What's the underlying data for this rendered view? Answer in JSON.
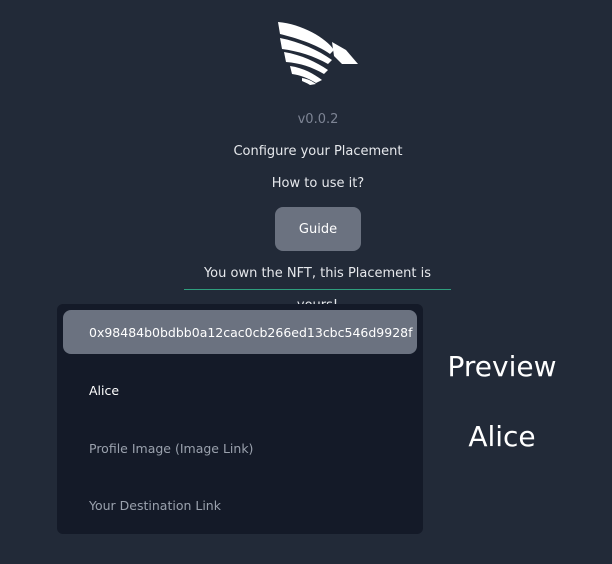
{
  "header": {
    "logo_icon": "wing-logo-icon",
    "version": "v0.0.2",
    "subtitle": "Configure your Placement",
    "howto": "How to use it?",
    "guide_label": "Guide",
    "ownership_message": "You own the NFT, this Placement is yours!"
  },
  "form": {
    "address_value": "0x98484b0bdbb0a12cac0cb266ed13cbc546d9928f",
    "name_value": "Alice",
    "image_placeholder": "Profile Image (Image Link)",
    "link_placeholder": "Your Destination Link"
  },
  "preview": {
    "title": "Preview",
    "name": "Alice"
  },
  "colors": {
    "background": "#222a38",
    "panel": "#141a28",
    "button": "#6b7280",
    "accent_underline": "#2f9e7e"
  }
}
